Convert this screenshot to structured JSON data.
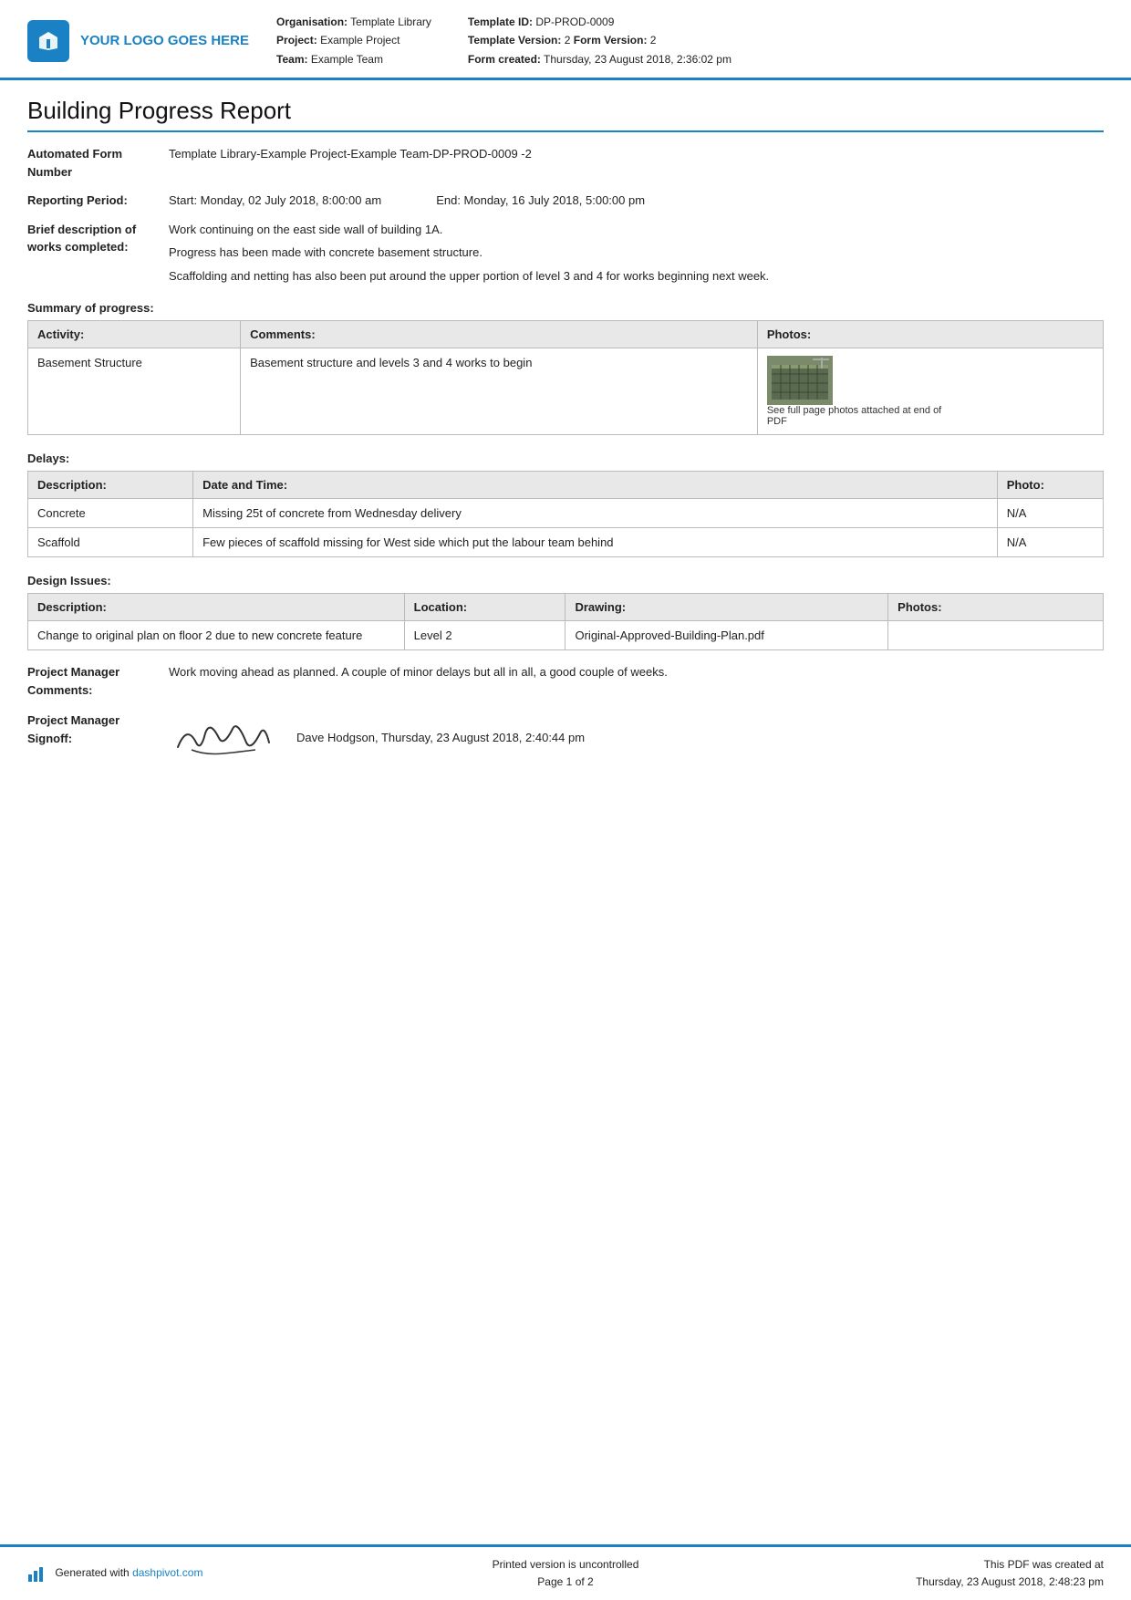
{
  "header": {
    "logo_text": "YOUR LOGO GOES HERE",
    "org_label": "Organisation:",
    "org_value": "Template Library",
    "project_label": "Project:",
    "project_value": "Example Project",
    "team_label": "Team:",
    "team_value": "Example Team",
    "template_id_label": "Template ID:",
    "template_id_value": "DP-PROD-0009",
    "template_version_label": "Template Version:",
    "template_version_value": "2",
    "form_version_label": "Form Version:",
    "form_version_value": "2",
    "form_created_label": "Form created:",
    "form_created_value": "Thursday, 23 August 2018, 2:36:02 pm"
  },
  "report": {
    "title": "Building Progress Report",
    "automated_form_number_label": "Automated Form Number",
    "automated_form_number_value": "Template Library-Example Project-Example Team-DP-PROD-0009  -2",
    "reporting_period_label": "Reporting Period:",
    "reporting_start": "Start: Monday, 02 July 2018, 8:00:00 am",
    "reporting_end": "End: Monday, 16 July 2018, 5:00:00 pm",
    "brief_desc_label": "Brief description of works completed:",
    "brief_desc_paras": [
      "Work continuing on the east side wall of building 1A.",
      "Progress has been made with concrete basement structure.",
      "Scaffolding and netting has also been put around the upper portion of level 3 and 4 for works beginning next week."
    ],
    "summary_heading": "Summary of progress:",
    "summary_table": {
      "headers": [
        "Activity:",
        "Comments:",
        "Photos:"
      ],
      "rows": [
        {
          "activity": "Basement Structure",
          "comments": "Basement structure and levels 3 and 4 works to begin",
          "photo_caption": "See full page photos attached at end of PDF"
        }
      ]
    },
    "delays_heading": "Delays:",
    "delays_table": {
      "headers": [
        "Description:",
        "Date and Time:",
        "Photo:"
      ],
      "rows": [
        {
          "description": "Concrete",
          "date_time": "Missing 25t of concrete from Wednesday delivery",
          "photo": "N/A"
        },
        {
          "description": "Scaffold",
          "date_time": "Few pieces of scaffold missing for West side which put the labour team behind",
          "photo": "N/A"
        }
      ]
    },
    "design_issues_heading": "Design Issues:",
    "design_issues_table": {
      "headers": [
        "Description:",
        "Location:",
        "Drawing:",
        "Photos:"
      ],
      "rows": [
        {
          "description": "Change to original plan on floor 2 due to new concrete feature",
          "location": "Level 2",
          "drawing": "Original-Approved-Building-Plan.pdf",
          "photos": ""
        }
      ]
    },
    "pm_comments_label": "Project Manager Comments:",
    "pm_comments_value": "Work moving ahead as planned. A couple of minor delays but all in all, a good couple of weeks.",
    "pm_signoff_label": "Project Manager Signoff:",
    "pm_signoff_name": "Dave Hodgson, Thursday, 23 August 2018, 2:40:44 pm"
  },
  "footer": {
    "generated_text": "Generated with ",
    "dashpivot_url": "dashpivot.com",
    "printed_version": "Printed version is uncontrolled",
    "page_label": "Page",
    "page_current": "1",
    "page_of": "of 2",
    "pdf_created_label": "This PDF was created at",
    "pdf_created_value": "Thursday, 23 August 2018, 2:48:23 pm"
  }
}
